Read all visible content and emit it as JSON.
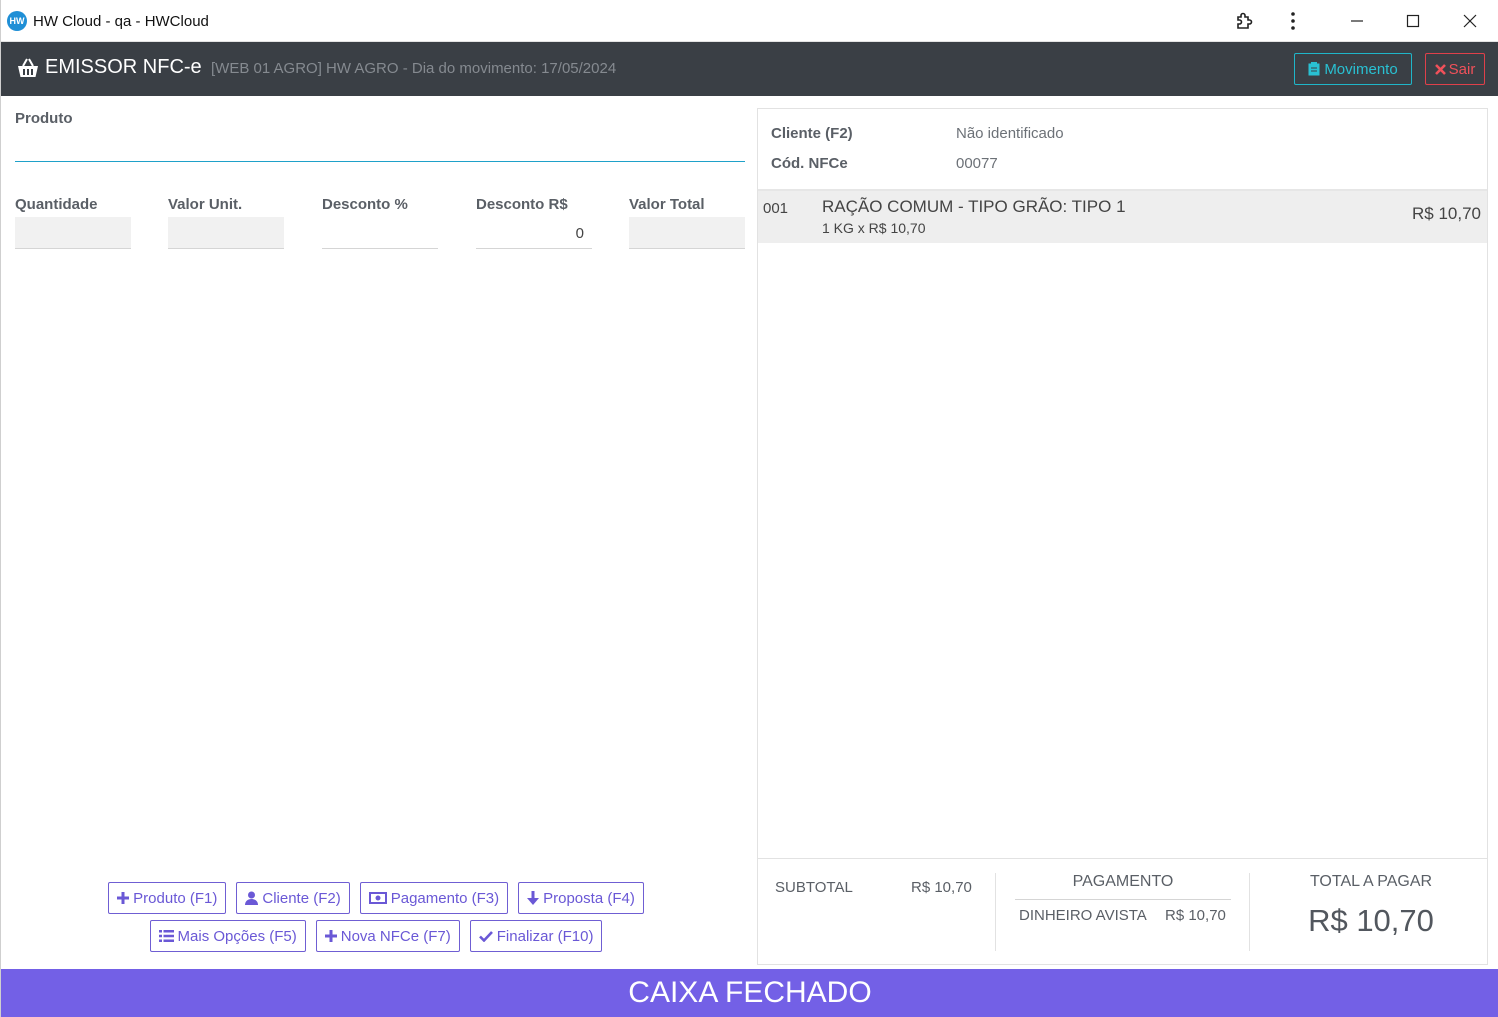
{
  "window": {
    "title": "HW Cloud - qa - HWCloud",
    "logo_text": "HW"
  },
  "header": {
    "app_name": "EMISSOR NFC-e",
    "subtitle": "[WEB 01 AGRO] HW AGRO - Dia do movimento: 17/05/2024",
    "movimento_label": "Movimento",
    "sair_label": "Sair"
  },
  "form": {
    "produto_label": "Produto",
    "quantidade_label": "Quantidade",
    "valor_unit_label": "Valor Unit.",
    "desconto_pct_label": "Desconto %",
    "desconto_rs_label": "Desconto R$",
    "desconto_rs_value": "0",
    "valor_total_label": "Valor Total"
  },
  "actions": {
    "produto": "Produto (F1)",
    "cliente": "Cliente (F2)",
    "pagamento": "Pagamento (F3)",
    "proposta": "Proposta (F4)",
    "mais_opcoes": "Mais Opções (F5)",
    "nova_nfce": "Nova NFCe (F7)",
    "finalizar": "Finalizar (F10)"
  },
  "summary": {
    "cliente_label": "Cliente (F2)",
    "cliente_value": "Não identificado",
    "cod_label": "Cód. NFCe",
    "cod_value": "00077"
  },
  "items": [
    {
      "code": "001",
      "name": "RAÇÃO COMUM - TIPO GRÃO: TIPO 1",
      "qty": "1 KG x R$ 10,70",
      "price": "R$ 10,70"
    }
  ],
  "totals": {
    "subtotal_label": "SUBTOTAL",
    "subtotal_value": "R$ 10,70",
    "pagamento_label": "PAGAMENTO",
    "pagamento_method": "DINHEIRO AVISTA",
    "pagamento_value": "R$ 10,70",
    "total_label": "TOTAL A PAGAR",
    "total_value": "R$ 10,70"
  },
  "status_banner": "CAIXA FECHADO",
  "colors": {
    "header_bg": "#3a3f45",
    "accent_purple": "#7360e6",
    "movimento_cyan": "#29c0d2",
    "sair_red": "#f0515a",
    "input_underline": "#1fa1c9"
  }
}
